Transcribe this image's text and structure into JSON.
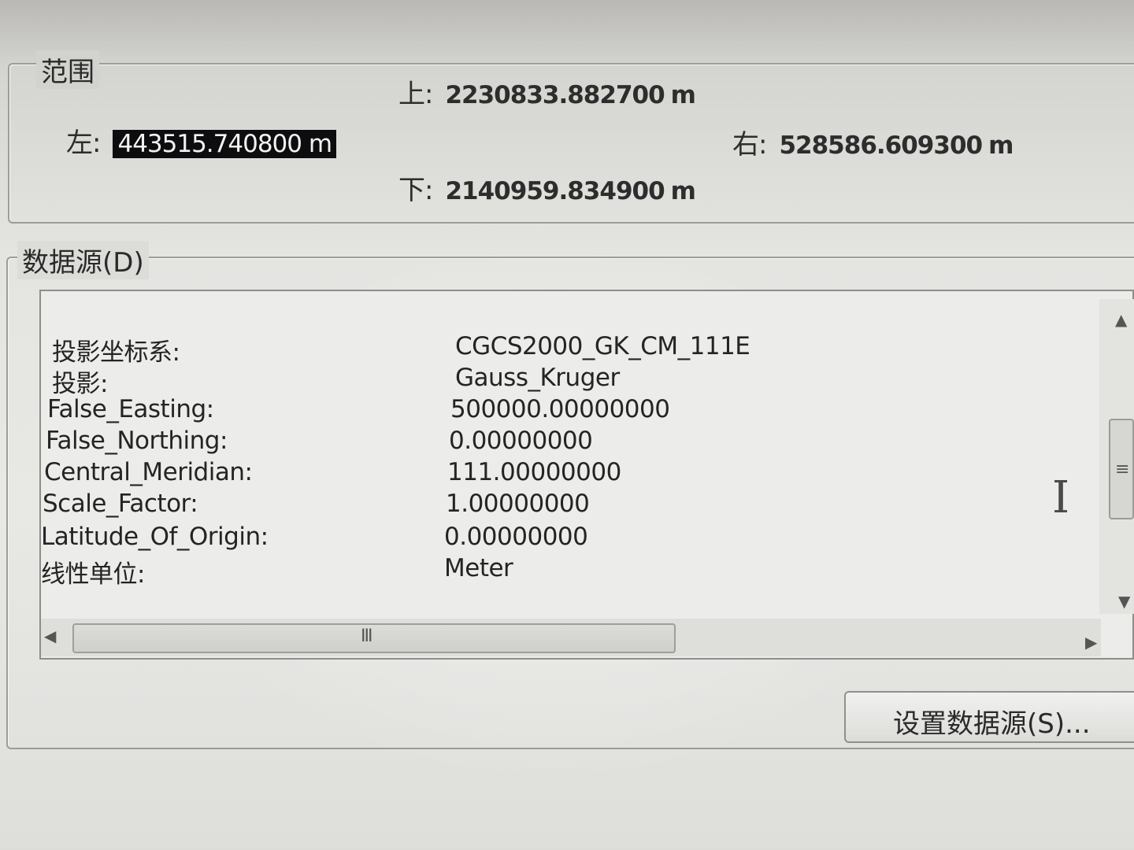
{
  "extent": {
    "title": "范围",
    "top": {
      "label": "上:",
      "value": "2230833.882700",
      "unit": "m"
    },
    "left": {
      "label": "左:",
      "value": "443515.740800",
      "unit": "m"
    },
    "right": {
      "label": "右:",
      "value": "528586.609300",
      "unit": "m"
    },
    "bottom": {
      "label": "下:",
      "value": "2140959.834900",
      "unit": "m"
    }
  },
  "datasource": {
    "title": "数据源(D)",
    "rows": [
      {
        "key": "投影坐标系:",
        "value": "CGCS2000_GK_CM_111E"
      },
      {
        "key": "投影:",
        "value": "Gauss_Kruger"
      },
      {
        "key": "False_Easting:",
        "value": "500000.00000000"
      },
      {
        "key": "False_Northing:",
        "value": "0.00000000"
      },
      {
        "key": "Central_Meridian:",
        "value": "111.00000000"
      },
      {
        "key": "Scale_Factor:",
        "value": "1.00000000"
      },
      {
        "key": "Latitude_Of_Origin:",
        "value": "0.00000000"
      },
      {
        "key": "线性单位:",
        "value": "Meter"
      }
    ],
    "set_button_label": "设置数据源(S)..."
  },
  "scrollbars": {
    "horizontal_grip": "III",
    "vertical_grip": "≡"
  }
}
